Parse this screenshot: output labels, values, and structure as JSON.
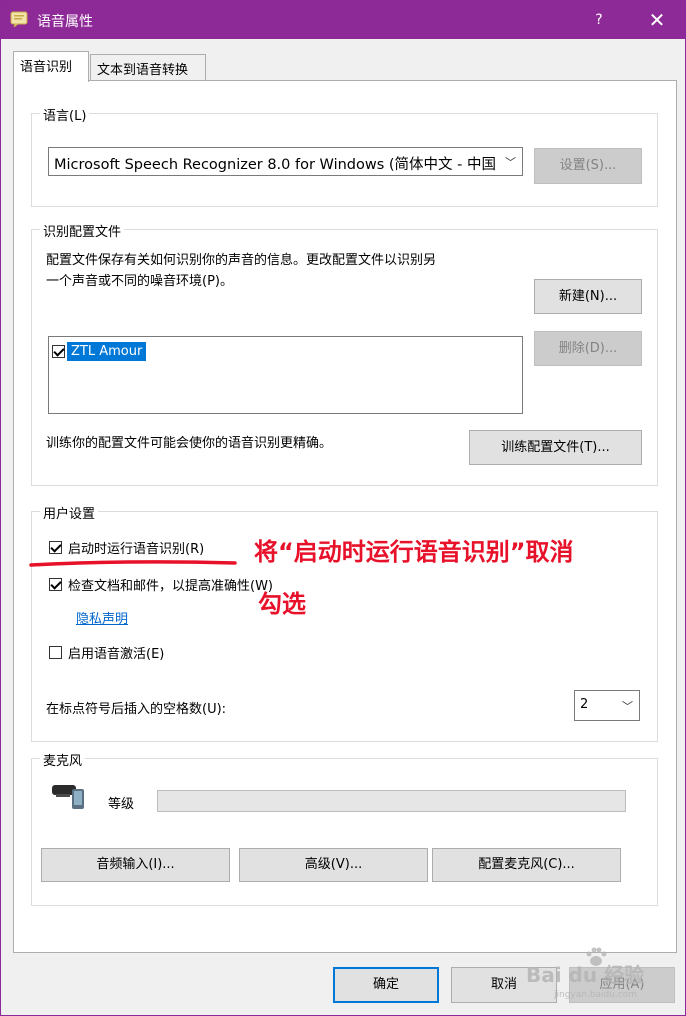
{
  "window": {
    "title": "语音属性",
    "help": "?",
    "close": "✕"
  },
  "tabs": [
    {
      "label": "语音识别",
      "active": true
    },
    {
      "label": "文本到语音转换",
      "active": false
    }
  ],
  "language": {
    "group_label": "语言(L)",
    "selected": "Microsoft Speech Recognizer 8.0 for Windows (简体中文 - 中国",
    "settings_button": "设置(S)..."
  },
  "profiles": {
    "group_label": "识别配置文件",
    "description_line1": "配置文件保存有关如何识别你的声音的信息。更改配置文件以识别另",
    "description_line2": "一个声音或不同的噪音环境(P)。",
    "new_button": "新建(N)...",
    "delete_button": "删除(D)...",
    "items": [
      {
        "label": "ZTL Amour",
        "checked": true,
        "selected": true
      }
    ],
    "train_hint": "训练你的配置文件可能会使你的语音识别更精确。",
    "train_button": "训练配置文件(T)..."
  },
  "user_settings": {
    "group_label": "用户设置",
    "run_at_startup": {
      "label": "启动时运行语音识别(R)",
      "checked": true
    },
    "review_docs": {
      "label": "检查文档和邮件，以提高准确性(W)",
      "checked": true
    },
    "privacy_link": "隐私声明",
    "voice_activation": {
      "label": "启用语音激活(E)",
      "checked": false
    },
    "spaces_label": "在标点符号后插入的空格数(U):",
    "spaces_value": "2"
  },
  "microphone": {
    "group_label": "麦克风",
    "level_label": "等级",
    "level": 0,
    "audio_input_button": "音频输入(I)...",
    "advanced_button": "高级(V)...",
    "configure_button": "配置麦克风(C)..."
  },
  "footer": {
    "ok": "确定",
    "cancel": "取消",
    "apply": "应用(A)"
  },
  "annotation": {
    "line1": "将“启动时运行语音识别”取消",
    "line2": "勾选",
    "color": "#e8112a"
  },
  "watermark": {
    "brand": "Bai du 经验",
    "url": "jingyan.baidu.com"
  },
  "colors": {
    "titlebar": "#8e2a97",
    "selection": "#0078d7",
    "link": "#0066cc"
  }
}
